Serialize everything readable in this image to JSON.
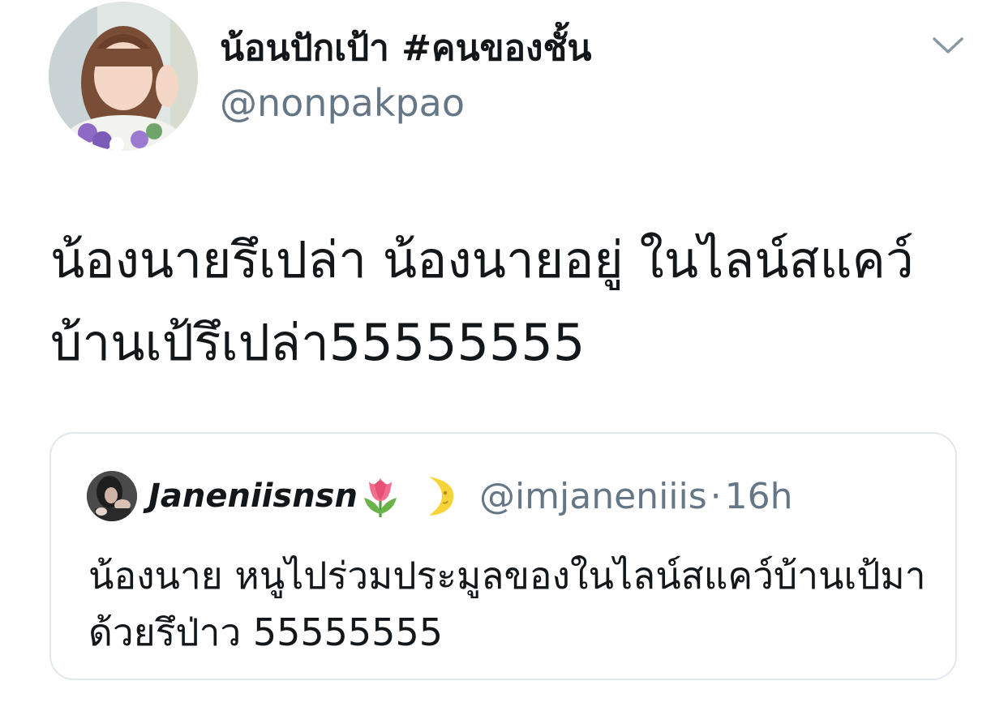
{
  "author": {
    "display_name": "น้อนปักเป้า #คนของชั้น",
    "handle": "@nonpakpao"
  },
  "tweet": {
    "text": "น้องนายรึเปล่า น้องนายอยู่ ในไลน์สแคว์บ้านเป้รึเปล่า55555555"
  },
  "quoted_tweet": {
    "display_name": "Janeniisnsn",
    "emojis": [
      "tulip-emoji",
      "crescent-moon-face-emoji"
    ],
    "handle": "@imjaneniiis",
    "separator": "·",
    "time": "16h",
    "text": "น้องนาย หนูไปร่วมประมูลของในไลน์สแคว์บ้านเป้มาด้วยรึป่าว 55555555"
  },
  "icons": {
    "menu": "chevron-down-icon"
  },
  "colors": {
    "text": "#14171a",
    "secondary": "#657786",
    "border": "#e1e8ed",
    "chevron": "#8899a6"
  }
}
